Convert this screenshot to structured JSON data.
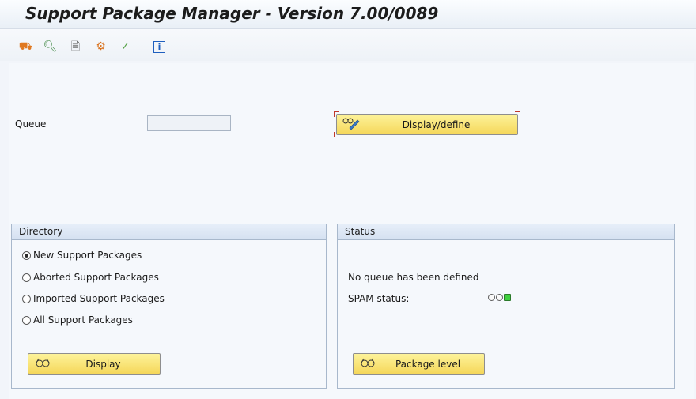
{
  "window": {
    "title": "Support Package Manager - Version 7.00/0089"
  },
  "toolbar": {
    "icons": [
      {
        "name": "transport-truck-icon",
        "glyph": "⛟",
        "color": "#e07820"
      },
      {
        "name": "magnifier-icon",
        "glyph": "🔍",
        "color": "#2f7d32"
      },
      {
        "name": "display-document-icon",
        "glyph": "🗎",
        "color": "#555555"
      },
      {
        "name": "package-tool-icon",
        "glyph": "⚙",
        "color": "#d9701b"
      },
      {
        "name": "check-pencil-icon",
        "glyph": "✓",
        "color": "#58a34a"
      },
      {
        "name": "info-icon",
        "glyph": "ℹ",
        "color": "#1f5fbf"
      }
    ]
  },
  "queue": {
    "label": "Queue",
    "value": "",
    "define_button": {
      "label": "Display/define",
      "icon": "glasses-pencil-icon"
    }
  },
  "directory": {
    "header": "Directory",
    "options": [
      {
        "label": "New Support Packages",
        "selected": true
      },
      {
        "label": "Aborted Support Packages",
        "selected": false
      },
      {
        "label": "Imported Support Packages",
        "selected": false
      },
      {
        "label": "All Support Packages",
        "selected": false
      }
    ],
    "display_button": {
      "label": "Display",
      "icon": "glasses-icon"
    }
  },
  "status": {
    "header": "Status",
    "message": "No queue has been defined",
    "spam_label": "SPAM status:",
    "spam_light": "green",
    "colors": {
      "green": "#3fd03f"
    },
    "level_button": {
      "label": "Package level",
      "icon": "glasses-icon"
    }
  }
}
